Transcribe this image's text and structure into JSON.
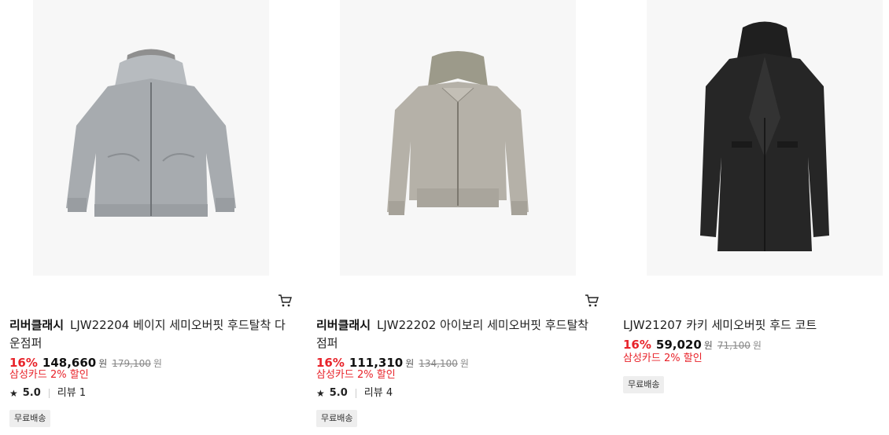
{
  "products": [
    {
      "brand": "리버클래시",
      "name": "LJW22204 베이지 세미오버핏 후드탈착 다운점퍼",
      "discount": "16%",
      "price": "148,660",
      "currency": "원",
      "original_price": "179,100",
      "card_promo": "삼성카드 2% 할인",
      "rating": "5.0",
      "reviews": "리뷰 1",
      "badge": "무료배송",
      "image_icon": "hooded-down-jacket-image",
      "image_color": "#a7abaf"
    },
    {
      "brand": "리버클래시",
      "name": "LJW22202 아이보리 세미오버핏 후드탈착 점퍼",
      "discount": "16%",
      "price": "111,310",
      "currency": "원",
      "original_price": "134,100",
      "card_promo": "삼성카드 2% 할인",
      "rating": "5.0",
      "reviews": "리뷰 4",
      "badge": "무료배송",
      "image_icon": "hooded-jumper-image",
      "image_color": "#b5b1a8"
    },
    {
      "brand": "",
      "name": "LJW21207 카키 세미오버핏 후드 코트",
      "discount": "16%",
      "price": "59,020",
      "currency": "원",
      "original_price": "71,100",
      "card_promo": "삼성카드 2% 할인",
      "rating": "",
      "reviews": "",
      "badge": "무료배송",
      "image_icon": "hooded-coat-image",
      "image_color": "#262626"
    }
  ],
  "colors": {
    "discount": "#e8232a",
    "image_bg": "#f7f7f7"
  },
  "icons": {
    "cart": "cart-icon",
    "star": "star-icon"
  }
}
